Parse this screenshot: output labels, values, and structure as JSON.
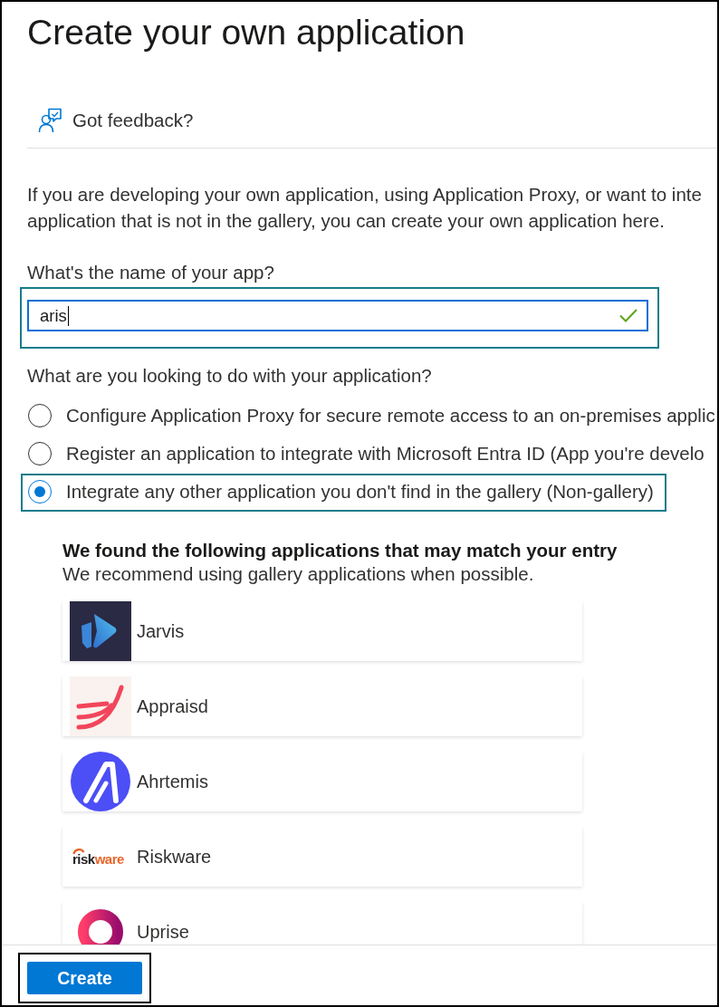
{
  "title": "Create your own application",
  "feedback": {
    "label": "Got feedback?"
  },
  "intro_lines": [
    "If you are developing your own application, using Application Proxy, or want to inte",
    "application that is not in the gallery, you can create your own application here."
  ],
  "name_field": {
    "label": "What's the name of your app?",
    "value": "aris",
    "focused": true,
    "valid": true,
    "highlighted": true
  },
  "purpose": {
    "label": "What are you looking to do with your application?",
    "options": [
      {
        "label": "Configure Application Proxy for secure remote access to an on-premises applic",
        "selected": false,
        "highlighted": false
      },
      {
        "label": "Register an application to integrate with Microsoft Entra ID (App you're develo",
        "selected": false,
        "highlighted": false
      },
      {
        "label": "Integrate any other application you don't find in the gallery (Non-gallery)",
        "selected": true,
        "highlighted": true
      }
    ]
  },
  "gallery": {
    "heading": "We found the following applications that may match your entry",
    "subtitle": "We recommend using gallery applications when possible.",
    "apps": [
      {
        "name": "Jarvis",
        "kind": "chevron"
      },
      {
        "name": "Appraisd",
        "kind": "stripes"
      },
      {
        "name": "Ahrtemis",
        "kind": "peak"
      },
      {
        "name": "Riskware",
        "kind": "wordmark",
        "logo_text": [
          "risk",
          "ware"
        ]
      },
      {
        "name": "Uprise",
        "kind": "ring"
      }
    ]
  },
  "footer": {
    "button": {
      "label": "Create",
      "highlighted": true
    }
  }
}
